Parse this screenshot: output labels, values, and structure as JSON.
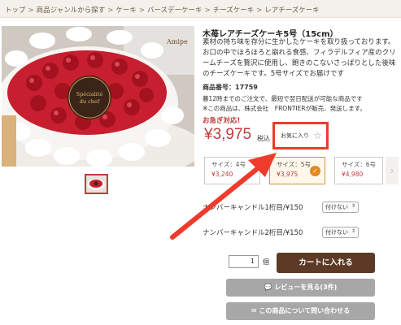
{
  "breadcrumb": [
    "トップ",
    "商品ジャンルから探す",
    "ケーキ",
    "バースデーケーキ",
    "チーズケーキ",
    "レアチーズケーキ"
  ],
  "photo": {
    "plaque_line1": "Spécialité",
    "plaque_line2": "du chef",
    "box_brand": "Amipe"
  },
  "product": {
    "title": "木苺レアチーズケーキ5号（15cm）",
    "description": "素材の持ち味を存分に生かしたケーキを取り扱っております。お口の中でほろほろと崩れる食感、フィラデルフィア産のクリームチーズを贅沢に使用し、飽きのこないさっぱりとした後味のチーズケーキです。5号サイズでお届けです",
    "code_label": "商品番号：",
    "code": "17759",
    "note1": "暮12時までのご注文で、最短で翌日配送が可能な商品です",
    "note2": "※この商品は、株式会社　FRONTIERが販売、発送します。",
    "urgent": "お急ぎ対応!",
    "price": "¥3,975",
    "tax": "税込"
  },
  "favorite": {
    "label": "お気に入り",
    "icon": "star-icon"
  },
  "sizes": [
    {
      "label": "サイズ：4号",
      "price": "¥3,240",
      "selected": false
    },
    {
      "label": "サイズ：5号",
      "price": "¥3,975",
      "selected": true
    },
    {
      "label": "サイズ：6号",
      "price": "¥4,980",
      "selected": false
    }
  ],
  "size_next": "›",
  "candles": [
    {
      "label": "ナンバーキャンドル1桁目/¥150",
      "value": "付けない"
    },
    {
      "label": "ナンバーキャンドル2桁目/¥150",
      "value": "付けない"
    }
  ],
  "cart": {
    "qty": "1",
    "unit": "個",
    "button": "カートに入れる"
  },
  "reviews_button": "レビューを見る(3件)",
  "inquiry_button": "この商品について問い合わせる",
  "colors": {
    "accent": "#c23b3b",
    "cart": "#5c3a25",
    "highlight": "#ee3b2b",
    "gray_button": "#a7a7a7"
  }
}
